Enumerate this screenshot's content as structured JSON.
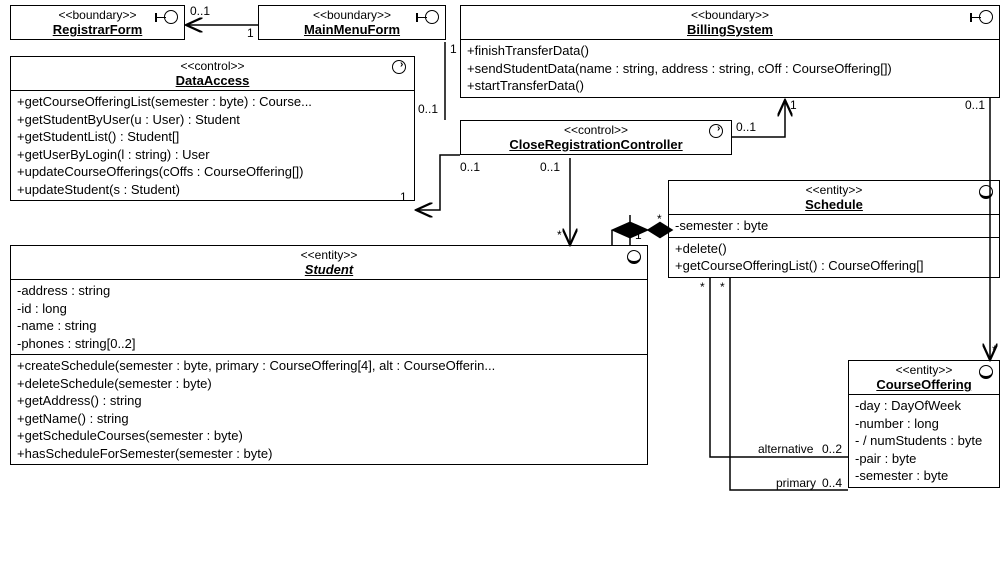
{
  "classes": {
    "registrarForm": {
      "stereotype": "<<boundary>>",
      "name": "RegistrarForm"
    },
    "mainMenuForm": {
      "stereotype": "<<boundary>>",
      "name": "MainMenuForm"
    },
    "billingSystem": {
      "stereotype": "<<boundary>>",
      "name": "BillingSystem",
      "ops": [
        "+finishTransferData()",
        "+sendStudentData(name : string, address : string, cOff : CourseOffering[])",
        "+startTransferData()"
      ]
    },
    "dataAccess": {
      "stereotype": "<<control>>",
      "name": "DataAccess",
      "ops": [
        "+getCourseOfferingList(semester : byte) : Course...",
        "+getStudentByUser(u : User) : Student",
        "+getStudentList() : Student[]",
        "+getUserByLogin(l : string) : User",
        "+updateCourseOfferings(cOffs : CourseOffering[])",
        "+updateStudent(s : Student)"
      ]
    },
    "closeRegController": {
      "stereotype": "<<control>>",
      "name": "CloseRegistrationController"
    },
    "schedule": {
      "stereotype": "<<entity>>",
      "name": "Schedule",
      "attrs": [
        "-semester : byte"
      ],
      "ops": [
        "+delete()",
        "+getCourseOfferingList() : CourseOffering[]"
      ]
    },
    "student": {
      "stereotype": "<<entity>>",
      "name": "Student",
      "attrs": [
        "-address : string",
        "-id : long",
        "-name : string",
        "-phones : string[0..2]"
      ],
      "ops": [
        "+createSchedule(semester : byte, primary : CourseOffering[4], alt : CourseOfferin...",
        "+deleteSchedule(semester : byte)",
        "+getAddress() : string",
        "+getName() : string",
        "+getScheduleCourses(semester : byte)",
        "+hasScheduleForSemester(semester : byte)"
      ]
    },
    "courseOffering": {
      "stereotype": "<<entity>>",
      "name": "CourseOffering",
      "attrs": [
        "-day : DayOfWeek",
        "-number : long",
        "- / numStudents : byte",
        "-pair : byte",
        "-semester : byte"
      ]
    }
  },
  "multiplicities": {
    "m01_a": "0..1",
    "m1_a": "1",
    "m1_b": "1",
    "m01_b": "0..1",
    "m1_c": "1",
    "m01_c": "0..1",
    "m01_d": "0..1",
    "m1_d": "1",
    "m01_e": "0..1",
    "m01_f": "0..1",
    "star_a": "*",
    "m1_e": "1",
    "star_b": "*",
    "star_c": "*",
    "star_d": "*",
    "star_e": "*",
    "alt": "alternative",
    "alt_m": "0..2",
    "prim": "primary",
    "prim_m": "0..4"
  },
  "chart_data": {
    "type": "uml_class_diagram",
    "classes": [
      {
        "name": "RegistrarForm",
        "stereotype": "boundary",
        "attributes": [],
        "operations": []
      },
      {
        "name": "MainMenuForm",
        "stereotype": "boundary",
        "attributes": [],
        "operations": []
      },
      {
        "name": "BillingSystem",
        "stereotype": "boundary",
        "attributes": [],
        "operations": [
          "finishTransferData()",
          "sendStudentData(name:string,address:string,cOff:CourseOffering[])",
          "startTransferData()"
        ]
      },
      {
        "name": "DataAccess",
        "stereotype": "control",
        "attributes": [],
        "operations": [
          "getCourseOfferingList(semester:byte):Course...",
          "getStudentByUser(u:User):Student",
          "getStudentList():Student[]",
          "getUserByLogin(l:string):User",
          "updateCourseOfferings(cOffs:CourseOffering[])",
          "updateStudent(s:Student)"
        ]
      },
      {
        "name": "CloseRegistrationController",
        "stereotype": "control",
        "attributes": [],
        "operations": []
      },
      {
        "name": "Schedule",
        "stereotype": "entity",
        "attributes": [
          "semester:byte"
        ],
        "operations": [
          "delete()",
          "getCourseOfferingList():CourseOffering[]"
        ]
      },
      {
        "name": "Student",
        "stereotype": "entity",
        "abstract": true,
        "attributes": [
          "address:string",
          "id:long",
          "name:string",
          "phones:string[0..2]"
        ],
        "operations": [
          "createSchedule(semester:byte,primary:CourseOffering[4],alt:CourseOffering...)",
          "deleteSchedule(semester:byte)",
          "getAddress():string",
          "getName():string",
          "getScheduleCourses(semester:byte)",
          "hasScheduleForSemester(semester:byte)"
        ]
      },
      {
        "name": "CourseOffering",
        "stereotype": "entity",
        "attributes": [
          "day:DayOfWeek",
          "number:long",
          "/numStudents:byte",
          "pair:byte",
          "semester:byte"
        ],
        "operations": []
      }
    ],
    "associations": [
      {
        "from": "MainMenuForm",
        "to": "RegistrarForm",
        "from_mult": "1",
        "to_mult": "0..1",
        "navigable_to": true
      },
      {
        "from": "MainMenuForm",
        "to": "CloseRegistrationController",
        "from_mult": "1",
        "to_mult": "0..1"
      },
      {
        "from": "CloseRegistrationController",
        "to": "DataAccess",
        "from_mult": "0..1",
        "to_mult": "1",
        "navigable_to": true
      },
      {
        "from": "CloseRegistrationController",
        "to": "BillingSystem",
        "from_mult": "0..1",
        "to_mult": "1",
        "navigable_to": true
      },
      {
        "from": "CloseRegistrationController",
        "to": "Student",
        "from_mult": "0..1",
        "to_mult": "*",
        "navigable_to": true
      },
      {
        "from": "BillingSystem",
        "to": "CourseOffering",
        "from_mult": "0..1",
        "to_mult": "*",
        "navigable_to": true
      },
      {
        "from": "Student",
        "to": "Schedule",
        "type": "composition",
        "from_mult": "1",
        "to_mult": "*"
      },
      {
        "from": "Schedule",
        "to": "CourseOffering",
        "role": "alternative",
        "from_mult": "*",
        "to_mult": "0..2"
      },
      {
        "from": "Schedule",
        "to": "CourseOffering",
        "role": "primary",
        "from_mult": "*",
        "to_mult": "0..4"
      }
    ]
  }
}
